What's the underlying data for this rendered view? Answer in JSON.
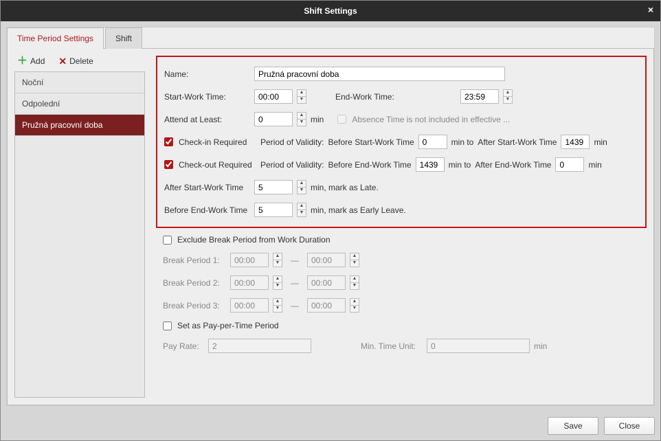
{
  "title": "Shift Settings",
  "tabs": [
    {
      "label": "Time Period Settings",
      "active": true
    },
    {
      "label": "Shift",
      "active": false
    }
  ],
  "toolbar": {
    "add": "Add",
    "delete": "Delete"
  },
  "list_items": [
    "Noční",
    "Odpolední",
    "Pružná pracovní doba"
  ],
  "list_selected_index": 2,
  "form": {
    "name_label": "Name:",
    "name_value": "Pružná pracovní doba",
    "start_label": "Start-Work Time:",
    "start_value": "00:00",
    "end_label": "End-Work Time:",
    "end_value": "23:59",
    "attend_label": "Attend at Least:",
    "attend_value": "0",
    "attend_unit": "min",
    "absence_label": "Absence Time is not included in effective ...",
    "checkin_label": "Check-in Required",
    "checkout_label": "Check-out Required",
    "pov_label": "Period of Validity:",
    "before_start_label": "Before Start-Work Time",
    "after_start_label": "After Start-Work Time",
    "before_end_label": "Before End-Work Time",
    "after_end_label": "After End-Work Time",
    "checkin_before": "0",
    "checkin_after": "1439",
    "checkout_before": "1439",
    "checkout_after": "0",
    "min_to": "min  to",
    "min": "min",
    "late_prefix": "After Start-Work Time",
    "late_value": "5",
    "late_suffix": "min,  mark as Late.",
    "early_prefix": "Before End-Work Time",
    "early_value": "5",
    "early_suffix": "min,  mark as Early Leave."
  },
  "break_section": {
    "exclude_label": "Exclude Break Period from Work Duration",
    "rows": [
      {
        "label": "Break Period  1:",
        "from": "00:00",
        "to": "00:00"
      },
      {
        "label": "Break Period  2:",
        "from": "00:00",
        "to": "00:00"
      },
      {
        "label": "Break Period  3:",
        "from": "00:00",
        "to": "00:00"
      }
    ],
    "dash": "—"
  },
  "pay_section": {
    "set_label": "Set as Pay-per-Time Period",
    "rate_label": "Pay Rate:",
    "rate_value": "2",
    "unit_label": "Min. Time Unit:",
    "unit_value": "0",
    "unit_suffix": "min"
  },
  "footer": {
    "save": "Save",
    "close": "Close"
  }
}
